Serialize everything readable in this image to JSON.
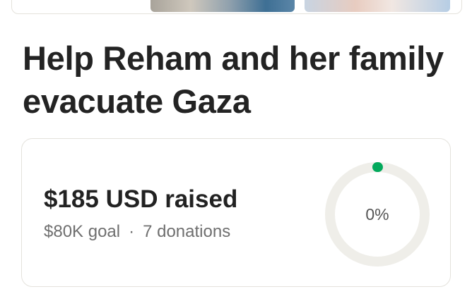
{
  "campaign": {
    "title": "Help Reham and her family evacuate Gaza"
  },
  "progress": {
    "raised_text": "$185 USD raised",
    "goal_text": "$80K goal",
    "separator": "·",
    "donations_text": "7 donations",
    "percent_text": "0%",
    "percent_value": 0.23
  },
  "colors": {
    "accent": "#02a95c",
    "ring_track": "#efeee9",
    "card_border": "#e4e2dc",
    "title_text": "#232323",
    "meta_text": "#6f6f6f"
  }
}
